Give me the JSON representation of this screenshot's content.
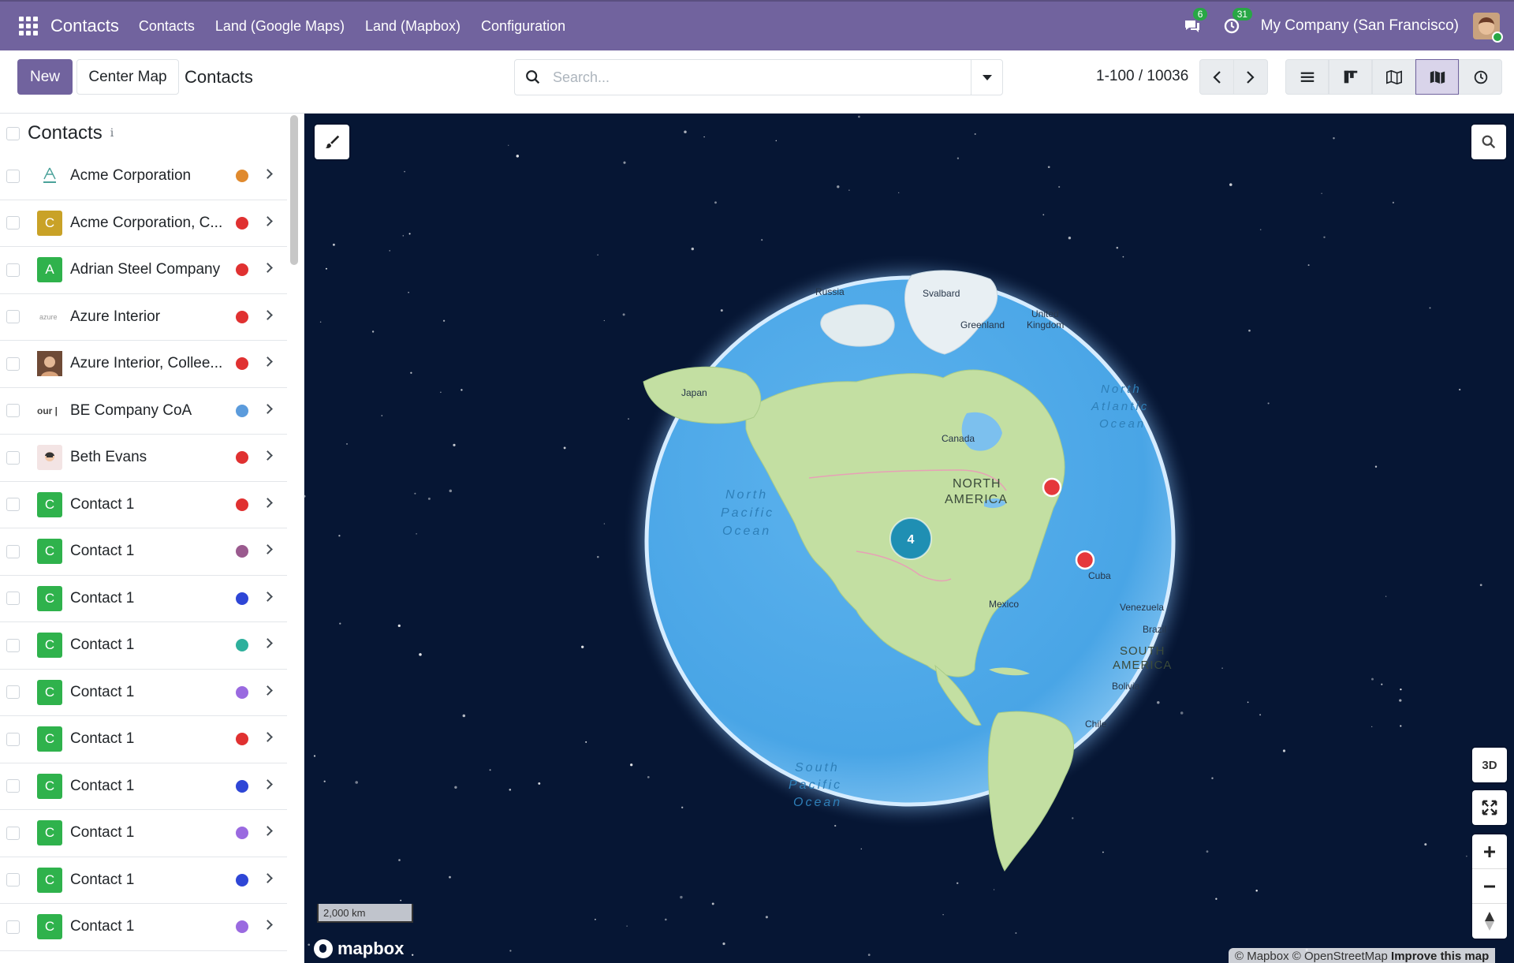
{
  "nav": {
    "brand": "Contacts",
    "links": [
      "Contacts",
      "Land (Google Maps)",
      "Land (Mapbox)",
      "Configuration"
    ],
    "messages_count": "6",
    "activities_count": "31",
    "company": "My Company (San Francisco)"
  },
  "control": {
    "new_label": "New",
    "center_label": "Center Map",
    "title": "Contacts",
    "search_placeholder": "Search...",
    "pager": "1-100 / 10036",
    "views": [
      "list-view-icon",
      "kanban-view-icon",
      "map-view-icon",
      "mapbox-view-icon",
      "activity-view-icon"
    ],
    "active_view": 3
  },
  "list": {
    "title": "Contacts",
    "info": "i",
    "rows": [
      {
        "name": "Acme Corporation",
        "avatar": "",
        "avatar_kind": "acme",
        "avatar_color": "#ffffff",
        "dot": "#e08a2e"
      },
      {
        "name": "Acme Corporation, C...",
        "avatar": "C",
        "avatar_color": "#c9a227",
        "dot": "#e03131"
      },
      {
        "name": "Adrian Steel Company",
        "avatar": "A",
        "avatar_color": "#2fb24c",
        "dot": "#e03131"
      },
      {
        "name": "Azure Interior",
        "avatar": "",
        "avatar_kind": "azure",
        "avatar_color": "#ffffff",
        "dot": "#e03131"
      },
      {
        "name": "Azure Interior, Collee...",
        "avatar": "",
        "avatar_kind": "photo",
        "avatar_color": "#8a5a3c",
        "dot": "#e03131"
      },
      {
        "name": "BE Company CoA",
        "avatar": "",
        "avatar_kind": "our",
        "avatar_color": "#ffffff",
        "dot": "#5b9bdc"
      },
      {
        "name": "Beth Evans",
        "avatar": "",
        "avatar_kind": "face",
        "avatar_color": "#f3e4e4",
        "dot": "#e03131"
      },
      {
        "name": "Contact 1",
        "avatar": "C",
        "avatar_color": "#2fb24c",
        "dot": "#e03131"
      },
      {
        "name": "Contact 1",
        "avatar": "C",
        "avatar_color": "#2fb24c",
        "dot": "#9a5a8e"
      },
      {
        "name": "Contact 1",
        "avatar": "C",
        "avatar_color": "#2fb24c",
        "dot": "#2e46d6"
      },
      {
        "name": "Contact 1",
        "avatar": "C",
        "avatar_color": "#2fb24c",
        "dot": "#2eb09c"
      },
      {
        "name": "Contact 1",
        "avatar": "C",
        "avatar_color": "#2fb24c",
        "dot": "#9a6ae0"
      },
      {
        "name": "Contact 1",
        "avatar": "C",
        "avatar_color": "#2fb24c",
        "dot": "#e03131"
      },
      {
        "name": "Contact 1",
        "avatar": "C",
        "avatar_color": "#2fb24c",
        "dot": "#2e46d6"
      },
      {
        "name": "Contact 1",
        "avatar": "C",
        "avatar_color": "#2fb24c",
        "dot": "#9a6ae0"
      },
      {
        "name": "Contact 1",
        "avatar": "C",
        "avatar_color": "#2fb24c",
        "dot": "#2e46d6"
      },
      {
        "name": "Contact 1",
        "avatar": "C",
        "avatar_color": "#2fb24c",
        "dot": "#9a6ae0"
      },
      {
        "name": "",
        "avatar": "",
        "avatar_color": "#2fb24c",
        "dot": ""
      }
    ]
  },
  "map": {
    "labels": {
      "russia": "Russia",
      "svalbard": "Svalbard",
      "greenland": "Greenland",
      "uk1": "United",
      "uk2": "Kingdom",
      "japan": "Japan",
      "canada": "Canada",
      "na1": "NORTH",
      "na2": "AMERICA",
      "np1": "North",
      "np2": "Pacific",
      "np3": "Ocean",
      "atl1": "North",
      "atl2": "Atlantic",
      "atl3": "Ocean",
      "cuba": "Cuba",
      "mexico": "Mexico",
      "venezuela": "Venezuela",
      "brazil": "Brazil",
      "sa1": "SOUTH",
      "sa2": "AMERICA",
      "bolivia": "Bolivia",
      "chile": "Chile",
      "sp1": "South",
      "sp2": "Pacific",
      "sp3": "Ocean"
    },
    "cluster_count": "4",
    "marker_color": "#e5383b",
    "cluster_color": "#1f8fb3",
    "ctrl_3d": "3D",
    "scale": "2,000 km",
    "logo": "mapbox",
    "attribution": "© Mapbox © OpenStreetMap",
    "improve": "Improve this map"
  }
}
